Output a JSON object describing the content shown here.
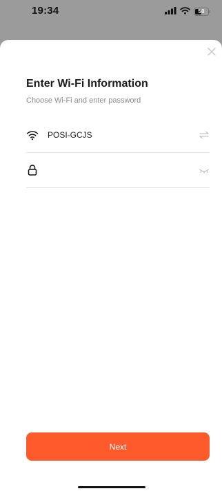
{
  "status_bar": {
    "time": "19:34",
    "battery_level": "50",
    "icons": [
      "signal-icon",
      "wifi-icon",
      "battery-icon"
    ]
  },
  "sheet": {
    "close_icon": "close-icon",
    "title": "Enter Wi-Fi Information",
    "subtitle": "Choose Wi-Fi and enter password",
    "wifi_row": {
      "icon": "wifi-icon",
      "network_name": "POSI-GCJS",
      "action_icon": "switch-network-icon"
    },
    "password_row": {
      "icon": "lock-icon",
      "value": "",
      "placeholder": "",
      "action_icon": "eye-closed-icon"
    },
    "next_label": "Next"
  },
  "colors": {
    "accent": "#ff5a2c",
    "overlay": "#9b9b9b",
    "divider": "#e6e6e6",
    "subtitle": "#8a8a8a"
  }
}
